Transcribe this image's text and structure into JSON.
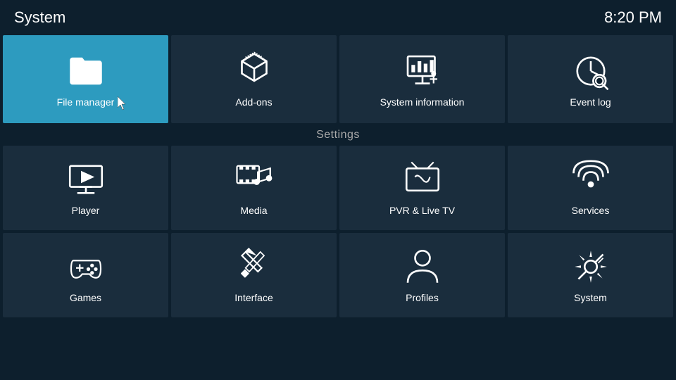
{
  "topbar": {
    "title": "System",
    "time": "8:20 PM"
  },
  "top_tiles": [
    {
      "id": "file-manager",
      "label": "File manager",
      "active": true
    },
    {
      "id": "add-ons",
      "label": "Add-ons",
      "active": false
    },
    {
      "id": "system-information",
      "label": "System information",
      "active": false
    },
    {
      "id": "event-log",
      "label": "Event log",
      "active": false
    }
  ],
  "settings_label": "Settings",
  "grid_row1": [
    {
      "id": "player",
      "label": "Player"
    },
    {
      "id": "media",
      "label": "Media"
    },
    {
      "id": "pvr-live-tv",
      "label": "PVR & Live TV"
    },
    {
      "id": "services",
      "label": "Services"
    }
  ],
  "grid_row2": [
    {
      "id": "games",
      "label": "Games"
    },
    {
      "id": "interface",
      "label": "Interface"
    },
    {
      "id": "profiles",
      "label": "Profiles"
    },
    {
      "id": "system",
      "label": "System"
    }
  ]
}
